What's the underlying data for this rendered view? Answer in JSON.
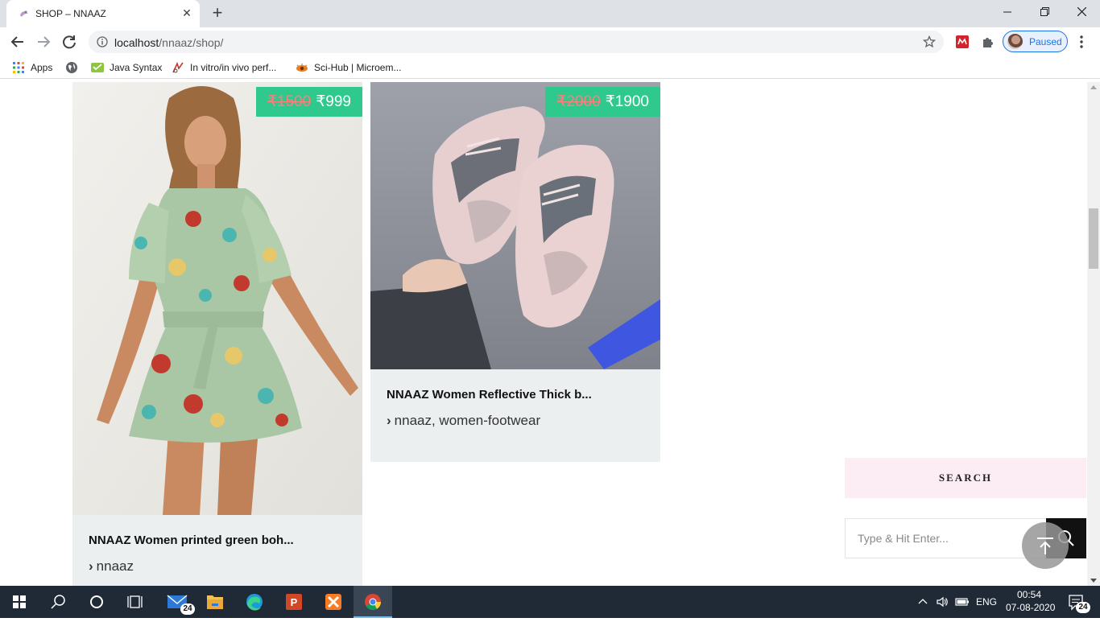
{
  "browser": {
    "tab_title": "SHOP – NNAAZ",
    "url_host": "localhost",
    "url_path": "/nnaaz/shop/",
    "profile_label": "Paused",
    "bookmarks": [
      {
        "label": "Apps",
        "icon": "apps-grid-icon"
      },
      {
        "label": "",
        "icon": "globe-icon"
      },
      {
        "label": "Java Syntax",
        "icon": "java-syntax-icon"
      },
      {
        "label": "In vitro/in vivo perf...",
        "icon": "invitro-icon"
      },
      {
        "label": "Sci-Hub | Microem...",
        "icon": "scihub-icon"
      }
    ]
  },
  "products": [
    {
      "price_old": "₹1500",
      "price_new": "₹999",
      "title": "NNAAZ Women printed green boh...",
      "categories": "nnaaz"
    },
    {
      "price_old": "₹2000",
      "price_new": "₹1900",
      "title": "NNAAZ Women Reflective Thick b...",
      "categories": "nnaaz, women-footwear"
    }
  ],
  "sidebar": {
    "search_heading": "SEARCH",
    "search_placeholder": "Type & Hit Enter..."
  },
  "taskbar": {
    "mail_badge": "24",
    "language": "ENG",
    "time": "00:54",
    "date": "07-08-2020",
    "notification_badge": "24"
  },
  "colors": {
    "price_badge": "#2fc98e",
    "search_heading_bg": "#fbedf3",
    "card_bg": "#eceff0"
  }
}
